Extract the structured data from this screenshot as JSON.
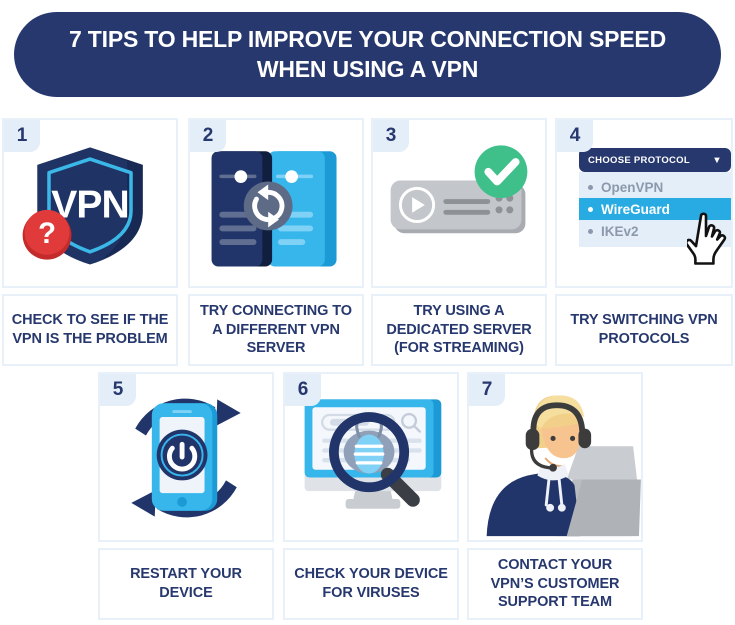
{
  "title": "7 TIPS TO HELP IMPROVE YOUR CONNECTION SPEED WHEN USING A VPN",
  "colors": {
    "navy": "#27386E",
    "light_blue": "#27ABE2",
    "panel_border": "#E8F1F9",
    "badge_bg": "#E4EEF8",
    "red": "#E03A3A",
    "green": "#3FC08A",
    "gray": "#B9BCC0"
  },
  "cards": [
    {
      "number": "1",
      "label": "CHECK TO SEE IF THE VPN IS THE PROBLEM",
      "icon": "vpn-shield-question-icon",
      "art": {
        "shield_text": "VPN",
        "badge_glyph": "?"
      }
    },
    {
      "number": "2",
      "label": "TRY CONNECTING TO A DIFFERENT VPN SERVER",
      "icon": "two-servers-sync-icon"
    },
    {
      "number": "3",
      "label": "TRY USING A DEDICATED SERVER (FOR STREAMING)",
      "icon": "media-server-check-icon"
    },
    {
      "number": "4",
      "label": "TRY SWITCHING VPN PROTOCOLS",
      "icon": "protocol-dropdown-icon",
      "dropdown": {
        "header_label": "CHOOSE PROTOCOL",
        "caret": "▼",
        "options": [
          "OpenVPN",
          "WireGuard",
          "IKEv2"
        ],
        "selected": "WireGuard"
      }
    },
    {
      "number": "5",
      "label": "RESTART YOUR DEVICE",
      "icon": "phone-restart-power-icon"
    },
    {
      "number": "6",
      "label": "CHECK YOUR DEVICE FOR VIRUSES",
      "icon": "monitor-magnifier-virus-icon"
    },
    {
      "number": "7",
      "label": "CONTACT YOUR VPN’S CUSTOMER SUPPORT TEAM",
      "icon": "support-agent-headset-icon"
    }
  ]
}
